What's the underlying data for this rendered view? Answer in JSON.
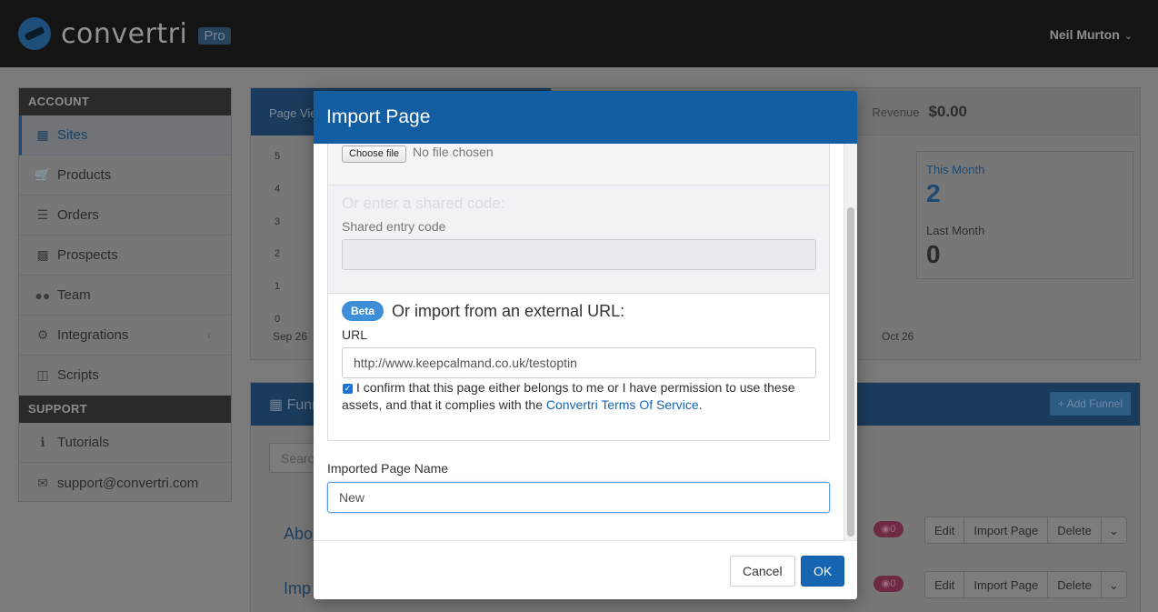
{
  "app": {
    "logo_text": "convertri",
    "badge": "Pro",
    "user_name": "Neil Murton"
  },
  "sidebar": {
    "account_heading": "ACCOUNT",
    "items": [
      {
        "label": "Sites",
        "icon": "grid-icon"
      },
      {
        "label": "Products",
        "icon": "cart-icon"
      },
      {
        "label": "Orders",
        "icon": "list-icon"
      },
      {
        "label": "Prospects",
        "icon": "briefcase-icon"
      },
      {
        "label": "Team",
        "icon": "users-icon"
      },
      {
        "label": "Integrations",
        "icon": "cogs-icon"
      },
      {
        "label": "Scripts",
        "icon": "code-file-icon"
      }
    ],
    "support_heading": "SUPPORT",
    "support_items": [
      {
        "label": "Tutorials",
        "icon": "info-icon"
      },
      {
        "label": "support@convertri.com",
        "icon": "envelope-icon"
      }
    ]
  },
  "stats": {
    "tab_label": "Page Vie",
    "revenue_label": "Revenue",
    "revenue_value": "$0.00",
    "y_ticks": [
      "5",
      "4",
      "3",
      "2",
      "1",
      "0"
    ],
    "x_ticks": [
      "Sep 26",
      "Oct 26"
    ],
    "this_month_label": "This Month",
    "this_month_value": "2",
    "last_month_label": "Last Month",
    "last_month_value": "0"
  },
  "funnels": {
    "heading": "Funn",
    "add_button": "+ Add Funnel",
    "search_placeholder": "Searc",
    "rows": [
      {
        "title": "Abo",
        "views": "0",
        "edit": "Edit",
        "import": "Import Page",
        "delete": "Delete"
      },
      {
        "title": "Imp",
        "views": "0",
        "edit": "Edit",
        "import": "Import Page",
        "delete": "Delete"
      }
    ]
  },
  "modal": {
    "title": "Import Page",
    "choose_file": "Choose file",
    "no_file": "No file chosen",
    "shared_title": "Or enter a shared code:",
    "shared_label": "Shared entry code",
    "shared_value": "",
    "beta": "Beta",
    "url_heading": "Or import from an external URL:",
    "url_label": "URL",
    "url_value": "http://www.keepcalmand.co.uk/testoptin",
    "confirm_text": "I confirm that this page either belongs to me or I have permission to use these assets, and that it complies with the",
    "confirm_link": "Convertri Terms Of Service",
    "confirm_end": ".",
    "confirm_checked": true,
    "name_label": "Imported Page Name",
    "name_value": "New ",
    "cancel": "Cancel",
    "ok": "OK"
  }
}
